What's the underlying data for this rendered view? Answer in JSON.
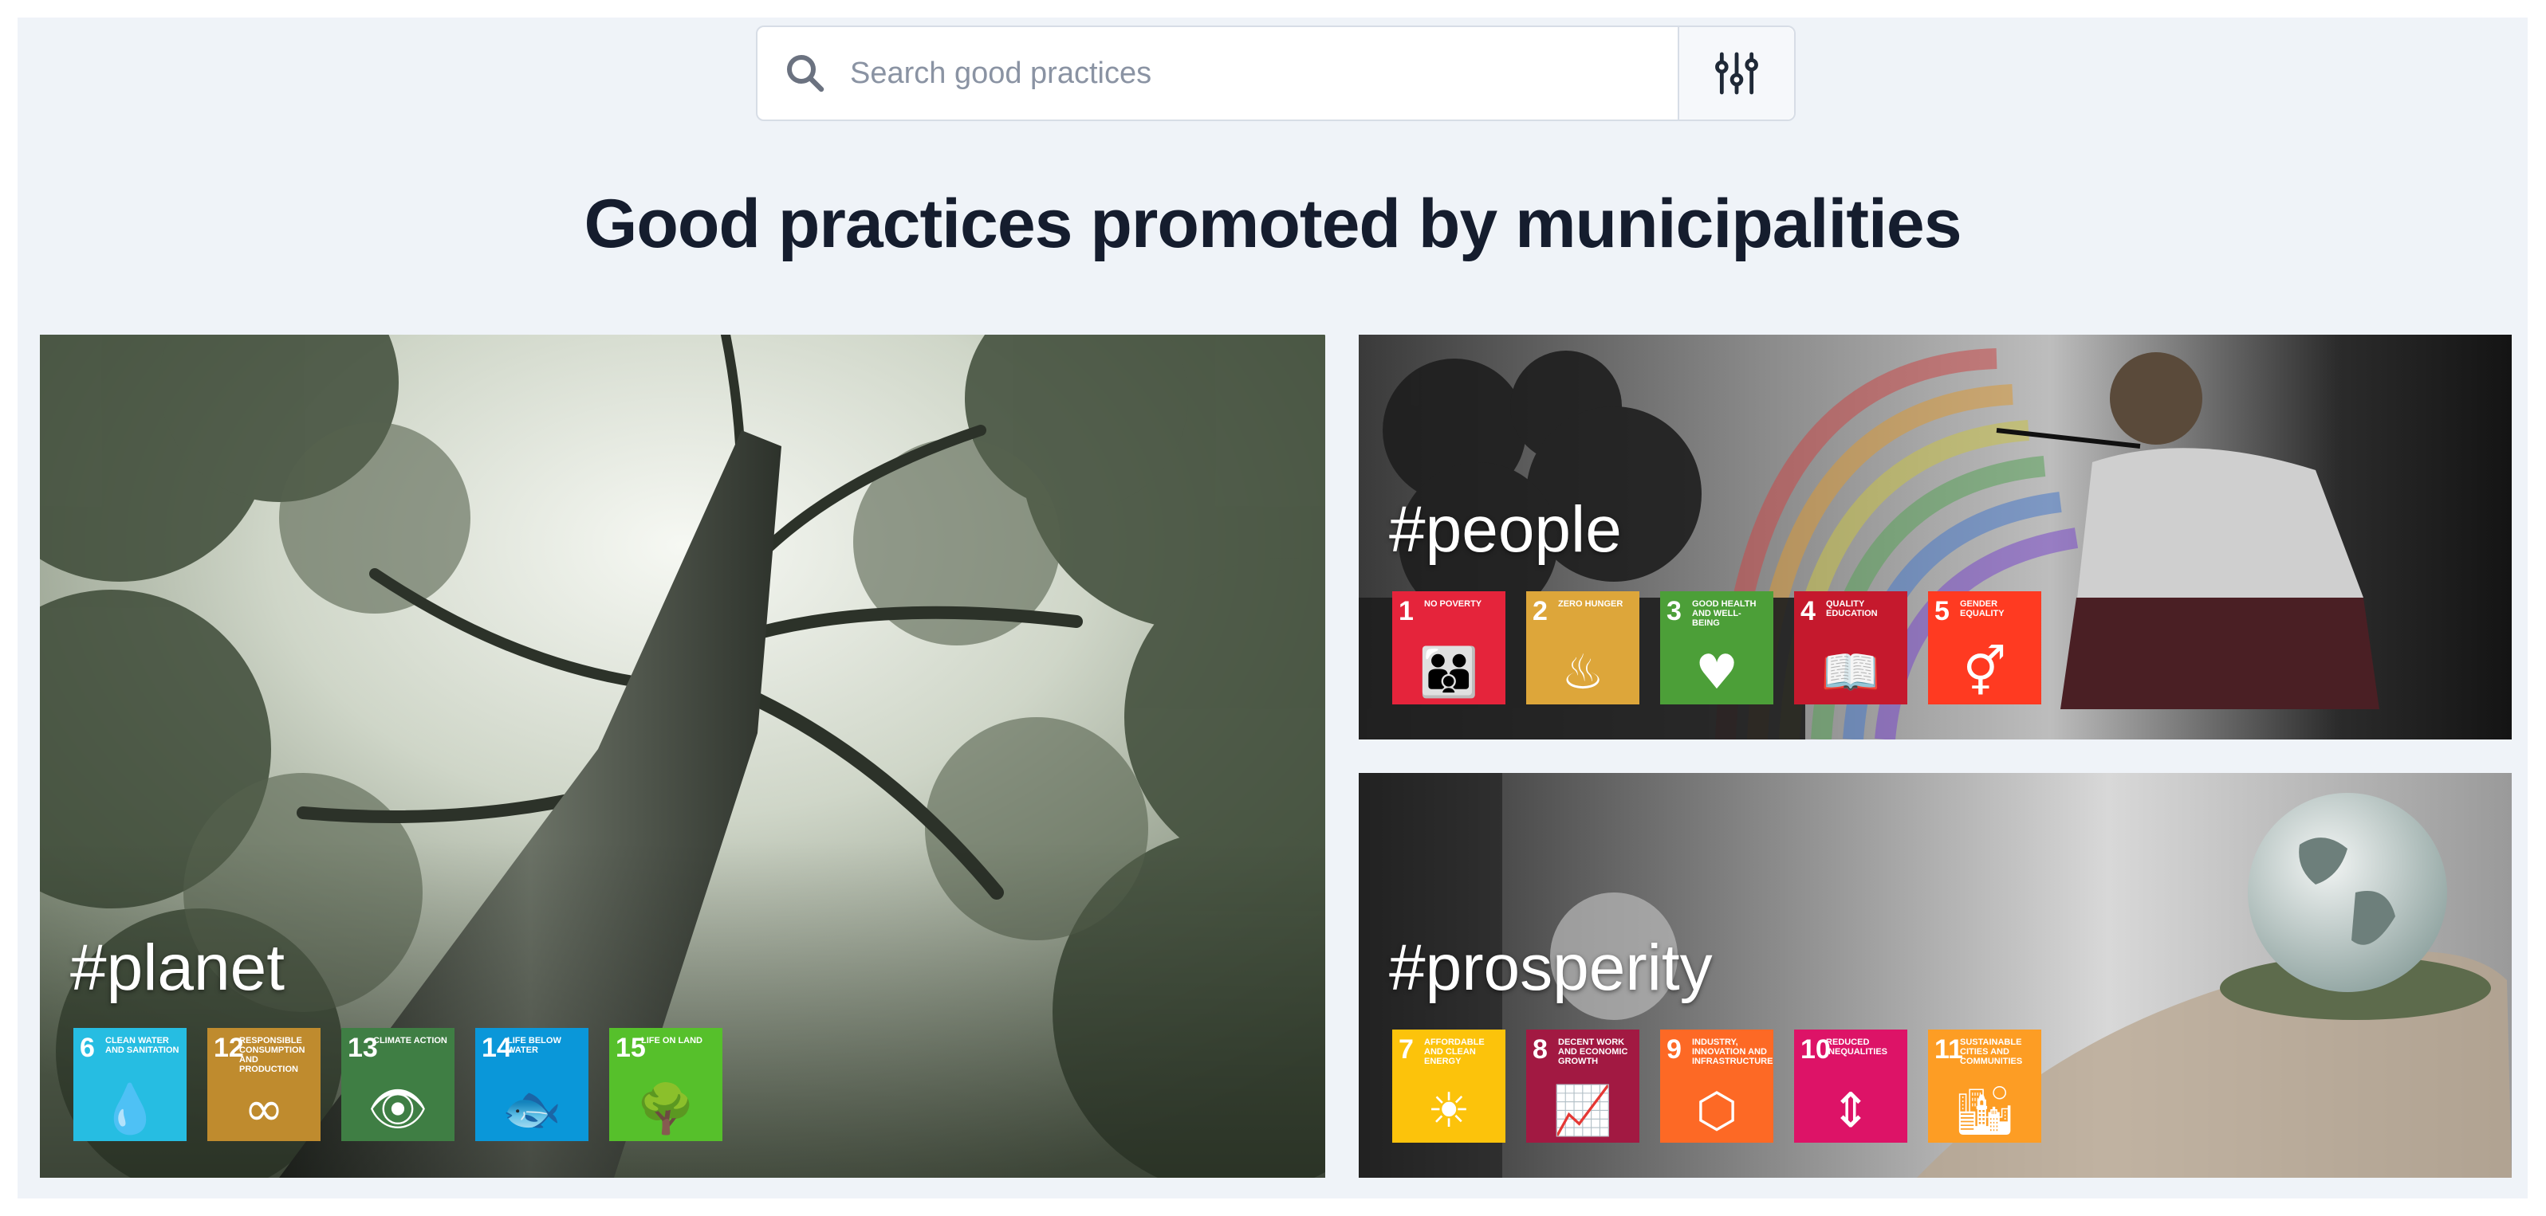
{
  "search": {
    "placeholder": "Search good practices"
  },
  "heading": "Good practices promoted by municipalities",
  "cards": {
    "planet": {
      "tag": "#planet",
      "goals": [
        {
          "num": "6",
          "label": "Clean water and sanitation",
          "color": "#26bde2",
          "icon": "💧"
        },
        {
          "num": "12",
          "label": "Responsible consumption and production",
          "color": "#bf8b2e",
          "icon": "∞"
        },
        {
          "num": "13",
          "label": "Climate action",
          "color": "#3f7e44",
          "icon": "👁"
        },
        {
          "num": "14",
          "label": "Life below water",
          "color": "#0a97d9",
          "icon": "🐟"
        },
        {
          "num": "15",
          "label": "Life on land",
          "color": "#56c02b",
          "icon": "🌳"
        }
      ]
    },
    "people": {
      "tag": "#people",
      "goals": [
        {
          "num": "1",
          "label": "No poverty",
          "color": "#e5243b",
          "icon": "👪"
        },
        {
          "num": "2",
          "label": "Zero hunger",
          "color": "#dda63a",
          "icon": "♨"
        },
        {
          "num": "3",
          "label": "Good health and well-being",
          "color": "#4c9f38",
          "icon": "♥"
        },
        {
          "num": "4",
          "label": "Quality education",
          "color": "#c5192d",
          "icon": "📖"
        },
        {
          "num": "5",
          "label": "Gender equality",
          "color": "#ff3a21",
          "icon": "⚥"
        }
      ]
    },
    "prosperity": {
      "tag": "#prosperity",
      "goals": [
        {
          "num": "7",
          "label": "Affordable and clean energy",
          "color": "#fcc30b",
          "icon": "☀"
        },
        {
          "num": "8",
          "label": "Decent work and economic growth",
          "color": "#a21942",
          "icon": "📈"
        },
        {
          "num": "9",
          "label": "Industry, innovation and infrastructure",
          "color": "#fd6925",
          "icon": "⬡"
        },
        {
          "num": "10",
          "label": "Reduced inequalities",
          "color": "#dd1367",
          "icon": "⇕"
        },
        {
          "num": "11",
          "label": "Sustainable cities and communities",
          "color": "#fd9d24",
          "icon": "🏙"
        }
      ]
    }
  }
}
